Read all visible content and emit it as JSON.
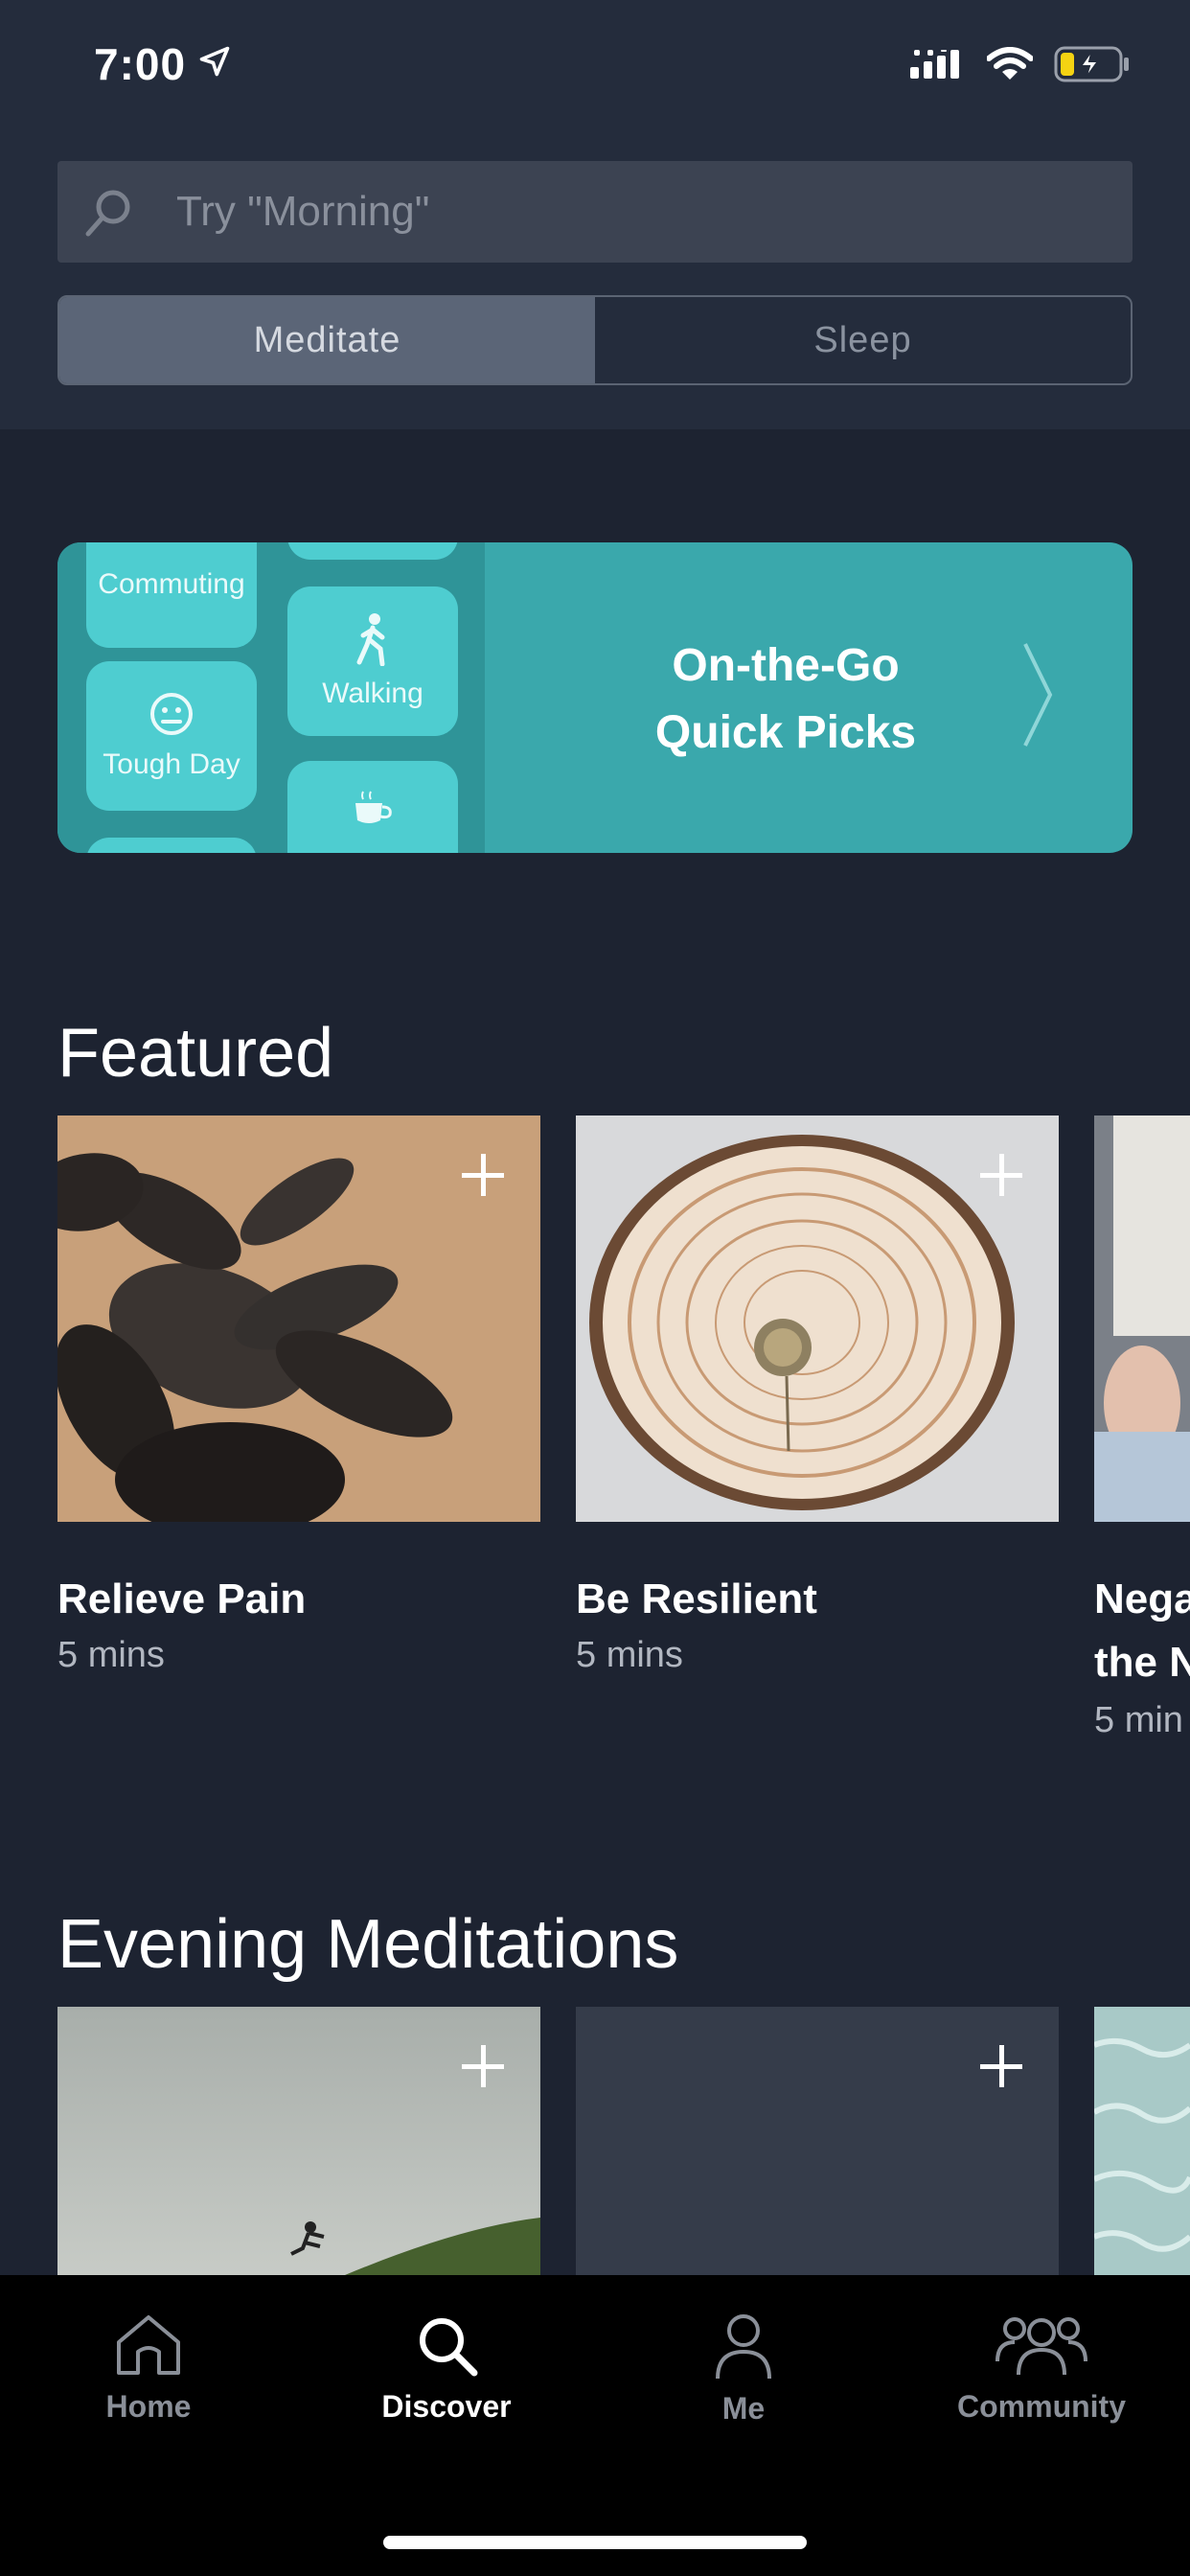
{
  "status_bar": {
    "time": "7:00"
  },
  "search": {
    "placeholder": "Try \"Morning\""
  },
  "segments": [
    {
      "label": "Meditate",
      "selected": true
    },
    {
      "label": "Sleep",
      "selected": false
    }
  ],
  "banner": {
    "title_line1": "On-the-Go",
    "title_line2": "Quick Picks",
    "tiles": [
      "Commuting",
      "Walking",
      "Tough Day"
    ]
  },
  "featured": {
    "title": "Featured",
    "cards": [
      {
        "title": "Relieve Pain",
        "duration": "5 mins"
      },
      {
        "title": "Be Resilient",
        "duration": "5 mins"
      },
      {
        "title_line1": "Nega",
        "title_line2": "the N",
        "duration": "5 min"
      }
    ]
  },
  "evening": {
    "title": "Evening Meditations"
  },
  "tabs": [
    {
      "label": "Home",
      "icon": "home-icon",
      "active": false
    },
    {
      "label": "Discover",
      "icon": "search-icon",
      "active": true
    },
    {
      "label": "Me",
      "icon": "person-icon",
      "active": false
    },
    {
      "label": "Community",
      "icon": "community-icon",
      "active": false
    }
  ],
  "colors": {
    "background": "#1d2331",
    "header": "#242c3c",
    "banner": "#3aa8ac",
    "tabbar": "#000000"
  }
}
